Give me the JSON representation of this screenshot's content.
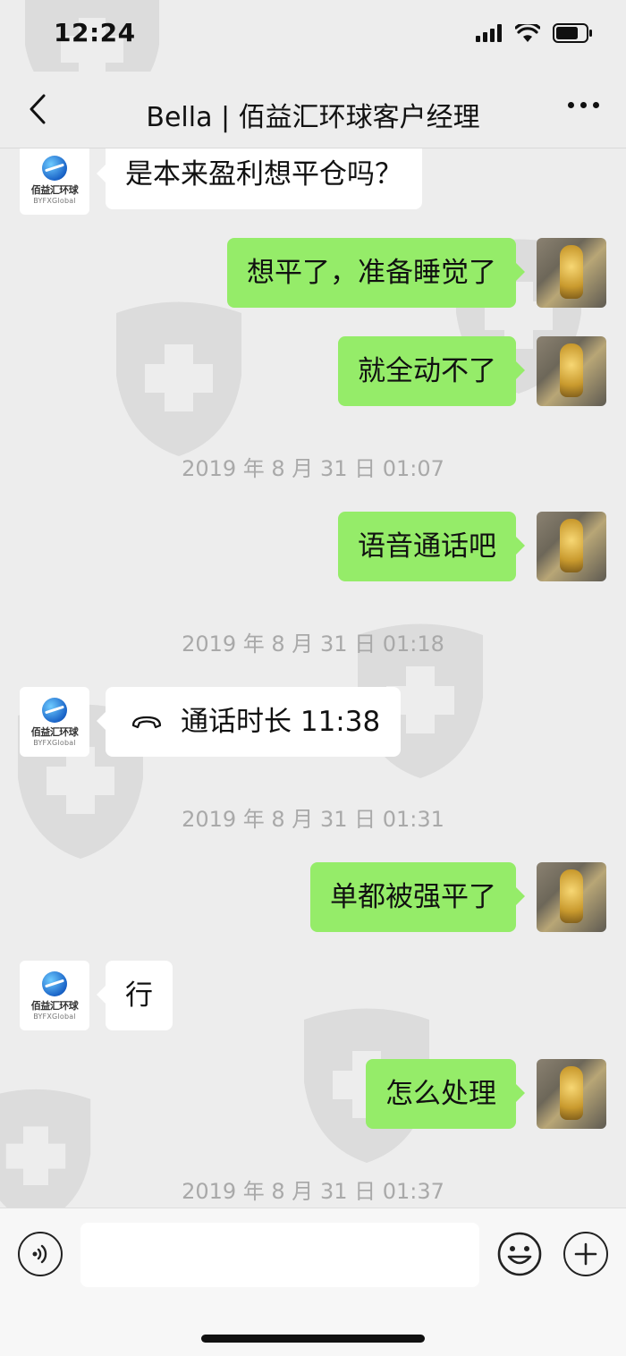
{
  "status_bar": {
    "time": "12:24",
    "icons": [
      "cellular-signal-icon",
      "wifi-icon",
      "battery-icon"
    ]
  },
  "nav": {
    "back_icon": "chevron-left-icon",
    "title": "Bella | 佰益汇环球客户经理",
    "more_icon": "more-dots-icon"
  },
  "contact_avatar": {
    "logo_cn": "佰益汇环球",
    "logo_en": "BYFXGlobal"
  },
  "messages": [
    {
      "side": "left",
      "type": "text",
      "text": "是本来盈利想平仓吗？"
    },
    {
      "side": "right",
      "type": "text",
      "text": "想平了，准备睡觉了"
    },
    {
      "side": "right",
      "type": "text",
      "text": "就全动不了"
    },
    {
      "type": "timestamp",
      "text": "2019 年 8 月 31 日 01:07"
    },
    {
      "side": "right",
      "type": "text",
      "text": "语音通话吧"
    },
    {
      "type": "timestamp",
      "text": "2019 年 8 月 31 日 01:18"
    },
    {
      "side": "left",
      "type": "call",
      "text": "通话时长 11:38",
      "icon": "phone-hangup-icon"
    },
    {
      "type": "timestamp",
      "text": "2019 年 8 月 31 日 01:31"
    },
    {
      "side": "right",
      "type": "text",
      "text": "单都被强平了"
    },
    {
      "side": "left",
      "type": "text",
      "text": "行"
    },
    {
      "side": "right",
      "type": "text",
      "text": "怎么处理"
    },
    {
      "type": "timestamp",
      "text": "2019 年 8 月 31 日 01:37"
    }
  ],
  "input_bar": {
    "voice_icon": "voice-input-icon",
    "input_value": "",
    "emoji_icon": "emoji-icon",
    "plus_icon": "plus-icon"
  },
  "colors": {
    "background": "#ededed",
    "sent_bubble": "#95ec69",
    "received_bubble": "#ffffff",
    "timestamp": "#a9a9a9",
    "watermark": "#d0d0d0"
  }
}
